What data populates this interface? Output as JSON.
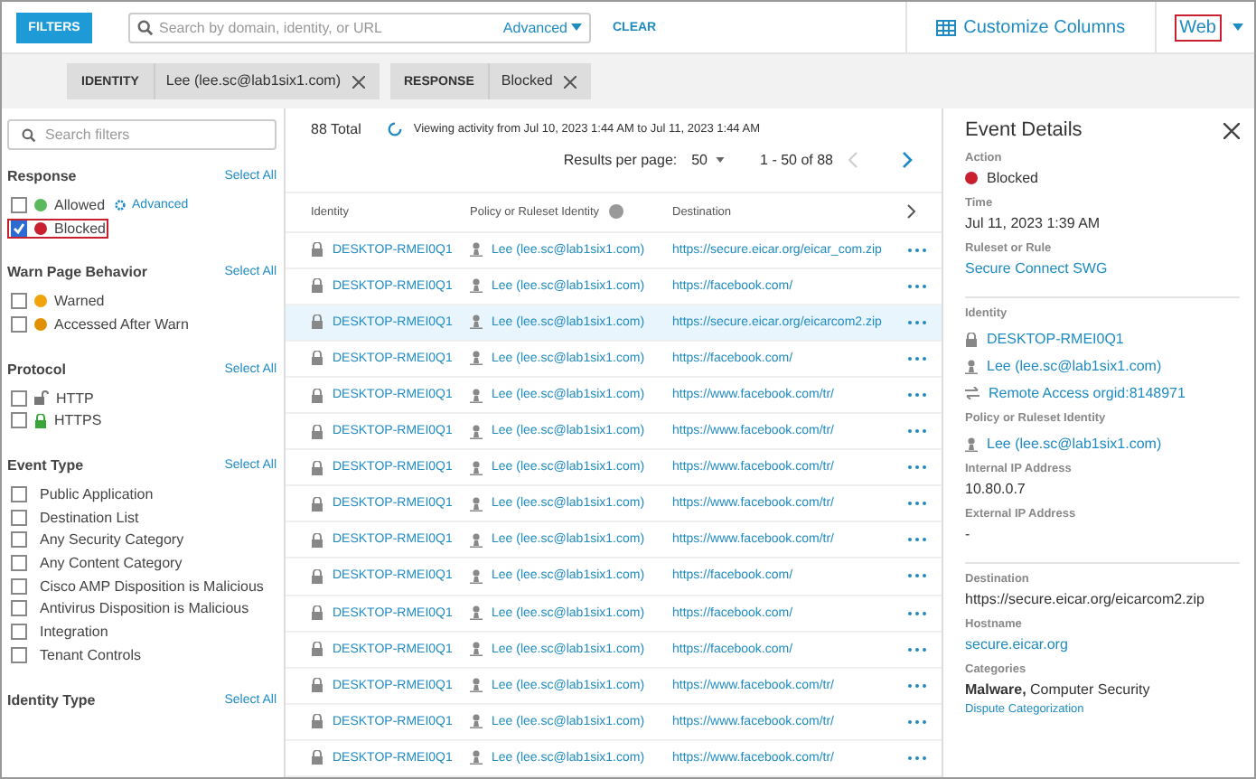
{
  "toolbar": {
    "filters_button": "FILTERS",
    "search": {
      "placeholder": "Search by domain, identity, or URL"
    },
    "advanced": "Advanced",
    "clear": "CLEAR",
    "customize": "Customize Columns",
    "web": {
      "label": "Web",
      "highlighted": true
    }
  },
  "chips": [
    {
      "name": "IDENTITY",
      "value": "Lee (lee.sc@lab1six1.com)"
    },
    {
      "name": "RESPONSE",
      "value": "Blocked"
    }
  ],
  "sidebar": {
    "search": {
      "placeholder": "Search filters"
    },
    "sections": [
      {
        "title": "Response",
        "select_all": "Select All",
        "items": [
          {
            "kind": "status",
            "label": "Allowed",
            "color": "#5cb85c",
            "checked": false,
            "highlighted": false,
            "link": "Advanced"
          },
          {
            "kind": "status",
            "label": "Blocked",
            "color": "#c9202f",
            "checked": true,
            "highlighted": true
          }
        ]
      },
      {
        "title": "Warn Page Behavior",
        "select_all": "Select All",
        "items": [
          {
            "kind": "status",
            "label": "Warned",
            "color": "#f0a30a",
            "checked": false,
            "highlighted": false
          },
          {
            "kind": "status",
            "label": "Accessed After Warn",
            "color": "#e09000",
            "checked": false,
            "highlighted": false
          }
        ]
      },
      {
        "title": "Protocol",
        "select_all": "Select All",
        "items": [
          {
            "kind": "protocol",
            "label": "HTTP",
            "secure": false,
            "checked": false,
            "highlighted": false
          },
          {
            "kind": "protocol",
            "label": "HTTPS",
            "secure": true,
            "checked": false,
            "highlighted": false
          }
        ]
      },
      {
        "title": "Event Type",
        "select_all": "Select All",
        "items": [
          {
            "kind": "plain",
            "label": "Public Application",
            "checked": false,
            "highlighted": false
          },
          {
            "kind": "plain",
            "label": "Destination List",
            "checked": false,
            "highlighted": false
          },
          {
            "kind": "plain",
            "label": "Any Security Category",
            "checked": false,
            "highlighted": false
          },
          {
            "kind": "plain",
            "label": "Any Content Category",
            "checked": false,
            "highlighted": false
          },
          {
            "kind": "plain",
            "label": "Cisco AMP Disposition is Malicious",
            "checked": false,
            "highlighted": false
          },
          {
            "kind": "plain",
            "label": "Antivirus Disposition is Malicious",
            "checked": false,
            "highlighted": false
          },
          {
            "kind": "plain",
            "label": "Integration",
            "checked": false,
            "highlighted": false
          },
          {
            "kind": "plain",
            "label": "Tenant Controls",
            "checked": false,
            "highlighted": false
          }
        ]
      },
      {
        "title": "Identity Type",
        "select_all": "Select All"
      }
    ]
  },
  "results": {
    "total": "88 Total",
    "viewing": "Viewing activity from Jul 10, 2023 1:44 AM to Jul 11, 2023 1:44 AM",
    "per_page_label": "Results per page:",
    "per_page": "50",
    "range": "1 - 50 of 88"
  },
  "table": {
    "columns": [
      "Identity",
      "Policy or Ruleset Identity",
      "Destination"
    ],
    "rows": [
      {
        "identity": "DESKTOP-RMEI0Q1",
        "policy": "Lee (lee.sc@lab1six1.com)",
        "destination": "https://secure.eicar.org/eicar_com.zip",
        "selected": false
      },
      {
        "identity": "DESKTOP-RMEI0Q1",
        "policy": "Lee (lee.sc@lab1six1.com)",
        "destination": "https://facebook.com/",
        "selected": false
      },
      {
        "identity": "DESKTOP-RMEI0Q1",
        "policy": "Lee (lee.sc@lab1six1.com)",
        "destination": "https://secure.eicar.org/eicarcom2.zip",
        "selected": true
      },
      {
        "identity": "DESKTOP-RMEI0Q1",
        "policy": "Lee (lee.sc@lab1six1.com)",
        "destination": "https://facebook.com/",
        "selected": false
      },
      {
        "identity": "DESKTOP-RMEI0Q1",
        "policy": "Lee (lee.sc@lab1six1.com)",
        "destination": "https://www.facebook.com/tr/",
        "selected": false
      },
      {
        "identity": "DESKTOP-RMEI0Q1",
        "policy": "Lee (lee.sc@lab1six1.com)",
        "destination": "https://www.facebook.com/tr/",
        "selected": false
      },
      {
        "identity": "DESKTOP-RMEI0Q1",
        "policy": "Lee (lee.sc@lab1six1.com)",
        "destination": "https://www.facebook.com/tr/",
        "selected": false
      },
      {
        "identity": "DESKTOP-RMEI0Q1",
        "policy": "Lee (lee.sc@lab1six1.com)",
        "destination": "https://www.facebook.com/tr/",
        "selected": false
      },
      {
        "identity": "DESKTOP-RMEI0Q1",
        "policy": "Lee (lee.sc@lab1six1.com)",
        "destination": "https://www.facebook.com/tr/",
        "selected": false
      },
      {
        "identity": "DESKTOP-RMEI0Q1",
        "policy": "Lee (lee.sc@lab1six1.com)",
        "destination": "https://facebook.com/",
        "selected": false
      },
      {
        "identity": "DESKTOP-RMEI0Q1",
        "policy": "Lee (lee.sc@lab1six1.com)",
        "destination": "https://facebook.com/",
        "selected": false
      },
      {
        "identity": "DESKTOP-RMEI0Q1",
        "policy": "Lee (lee.sc@lab1six1.com)",
        "destination": "https://facebook.com/",
        "selected": false
      },
      {
        "identity": "DESKTOP-RMEI0Q1",
        "policy": "Lee (lee.sc@lab1six1.com)",
        "destination": "https://www.facebook.com/tr/",
        "selected": false
      },
      {
        "identity": "DESKTOP-RMEI0Q1",
        "policy": "Lee (lee.sc@lab1six1.com)",
        "destination": "https://www.facebook.com/tr/",
        "selected": false
      },
      {
        "identity": "DESKTOP-RMEI0Q1",
        "policy": "Lee (lee.sc@lab1six1.com)",
        "destination": "https://www.facebook.com/tr/",
        "selected": false
      }
    ]
  },
  "details": {
    "title": "Event Details",
    "groups": [
      [
        {
          "label": "Action",
          "kind": "status",
          "value": "Blocked",
          "color": "#c9202f"
        },
        {
          "label": "Time",
          "kind": "text",
          "value": "Jul 11, 2023 1:39 AM"
        },
        {
          "label": "Ruleset or Rule",
          "kind": "link",
          "value": "Secure Connect SWG"
        }
      ],
      [
        {
          "label": "Identity",
          "kind": "identities",
          "items": [
            {
              "kind": "device",
              "text": "DESKTOP-RMEI0Q1"
            },
            {
              "kind": "user",
              "text": "Lee (lee.sc@lab1six1.com)"
            },
            {
              "kind": "network",
              "text": "Remote Access orgid:8148971"
            }
          ]
        },
        {
          "label": "Policy or Ruleset Identity",
          "kind": "identities",
          "items": [
            {
              "kind": "user",
              "text": "Lee (lee.sc@lab1six1.com)"
            }
          ]
        },
        {
          "label": "Internal IP Address",
          "kind": "text",
          "value": "10.80.0.7"
        },
        {
          "label": "External IP Address",
          "kind": "text",
          "value": "-"
        }
      ],
      [
        {
          "label": "Destination",
          "kind": "text",
          "value": "https://secure.eicar.org/eicarcom2.zip"
        },
        {
          "label": "Hostname",
          "kind": "link",
          "value": "secure.eicar.org"
        },
        {
          "label": "Categories",
          "kind": "text",
          "value": "**Malware,** Computer Security",
          "link": "Dispute Categorization"
        }
      ]
    ]
  }
}
